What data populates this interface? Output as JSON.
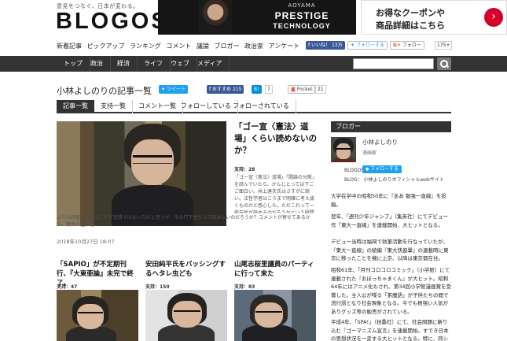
{
  "header": {
    "tagline": "意見をつなぐ、日本が変わる。",
    "logo": "BLOGOS",
    "ad1": {
      "sub": "AOYAMA",
      "main": "PRESTIGE",
      "main2": "TECHNOLOGY"
    },
    "ad2": {
      "line1": "お得なクーポンや",
      "line2": "商品詳細はこちら",
      "arrow": "›"
    },
    "subnav": [
      "新着記事",
      "ピックアップ",
      "ランキング",
      "コメント",
      "議論",
      "ブロガー",
      "政治家",
      "アンケート"
    ],
    "social": {
      "fb_like": "いいね！",
      "fb_count": "13万",
      "tw_follow": "フォローする",
      "gp_label": "フォロー",
      "gp_count": "175+"
    }
  },
  "mainnav": [
    "トップ",
    "政治",
    "経済",
    "ライフ",
    "ウェブ",
    "メディア"
  ],
  "title_bar": {
    "title": "小林よしのりの記事一覧",
    "tweet": "ツイート",
    "fb_recommend": "おすすめ",
    "fb_count": "215",
    "hatena": "B!",
    "hatena_count": "7",
    "pocket": "Pocket",
    "pocket_count": "21"
  },
  "page_tabs": [
    "記事一覧",
    "支持一覧",
    "コメント一覧",
    "フォローしている",
    "フォローされている"
  ],
  "hero": {
    "title": "「ゴー宣〈憲法〉道場」くらい読めないのか？",
    "support": "支持：28",
    "excerpt": "「ゴー宣〈憲法〉道場」『闘論の分断』を読んでいたら、かんじとっては下ごご面白い。井上達夫氏はさすがに鋭い。法哲学者はこうまで明確に考え抜くものかと感心した。ただこれって一般市民が読めるのだろうかという疑問がどうしても残る。そもそも「ゴー宣道場」の門下生はまったくの一般市民",
    "excerpt2": "よりは読書や考えることが習慣ではない方だと思うが、その門下生だって読めないのだろうか？コメントが寄せてあるから、賛否の注釈を…",
    "date": "2018年10月27日 18:07"
  },
  "cards": [
    {
      "title": "「SAPIO」が不定期刊行、『大東亜論』未完で終了。",
      "support": "支持：47"
    },
    {
      "title": "安田純平氏をバッシングするヘタレ虫ども",
      "support": "支持：150"
    },
    {
      "title": "山尾志桜里議員のパーティに行って来た",
      "support": "支持：83"
    }
  ],
  "sidebar": {
    "header": "ブロガー",
    "name": "小林よしのり",
    "job": "漫画家",
    "blogos_label": "BLOGOS：",
    "follow": "フォローする",
    "blog_label": "BLOG：",
    "blog_text": "小林よしのりオフィシャルwebサイト",
    "paragraphs": [
      "大学在学中の昭和50年に『ああ 勉強一直線』を投稿。",
      "翌年、「週刊少年ジャンプ」（集英社）にてデビュー作『東大一直線』を連載開始、大ヒットとなる。",
      "デビュー当時は福岡で執筆活動を行なっていたが、『東大一直線』の続編『東大快進撃』の連載時に東京に移ったことを機に上京、以降は東京都在住。",
      "昭和61年、「月刊コロコロコミック」（小学館）にて連載された『おぼっちゃまくん』が大ヒット。昭和64年にはアニメ化もされ、第34回小学館漫画賞を受賞した。主人公が喋る「茶魔語」が子供たちの間で流行語となり社会現象となる。今でも根強い人気がありグッズ等の販売がされている。",
      "平成4年、「SPA!」（扶桑社）にて、社会問題に斬り込む『ゴーマニズム宣言』を連載開始。すでき日本の思想状況を一変する大ヒットとなる。特に、同シリーズ"
    ]
  }
}
